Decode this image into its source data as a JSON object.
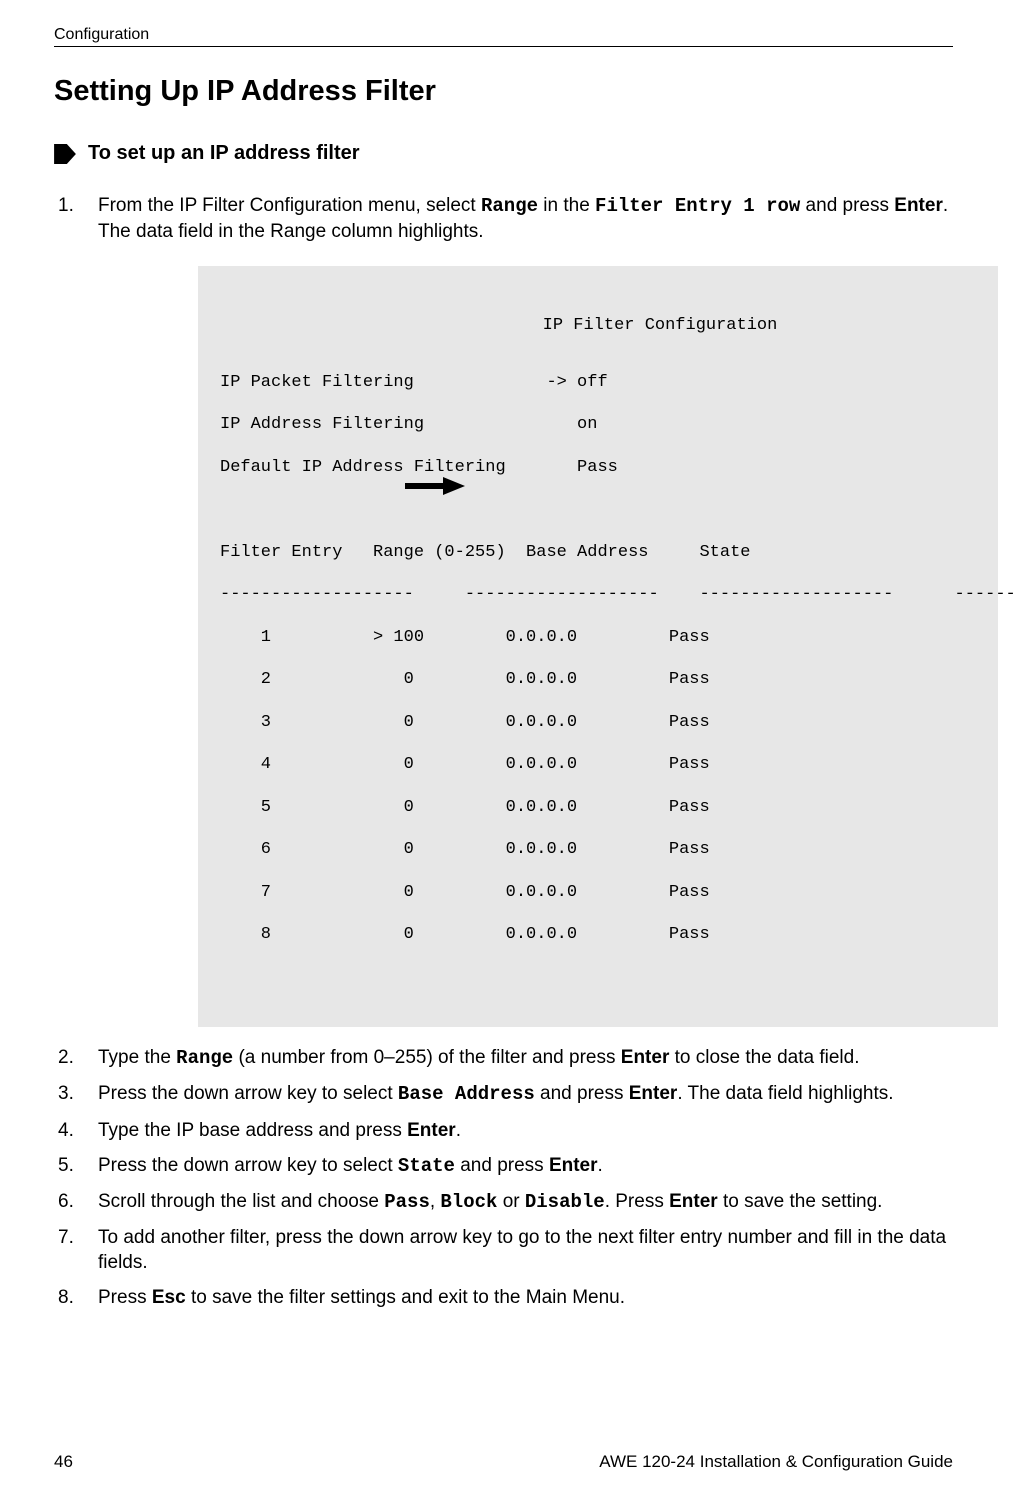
{
  "header": {
    "running": "Configuration"
  },
  "title": "Setting Up IP Address Filter",
  "task": "To set up an IP address filter",
  "steps": {
    "s1a": "From the IP Filter Configuration menu, select ",
    "s1b": "Range",
    "s1c": " in the ",
    "s1d": "Filter Entry 1 row",
    "s1e": " and press ",
    "s1f": "Enter",
    "s1g": ". The data field in the Range column highlights.",
    "s2a": "Type the ",
    "s2b": "Range",
    "s2c": " (a number from 0–255) of the filter and press ",
    "s2d": "Enter",
    "s2e": " to close the data field.",
    "s3a": "Press the down arrow key to select ",
    "s3b": "Base Address",
    "s3c": " and press ",
    "s3d": "Enter",
    "s3e": ". The data field highlights.",
    "s4a": "Type the IP base address and press ",
    "s4b": "Enter",
    "s4c": ".",
    "s5a": "Press the down arrow key to select ",
    "s5b": "State",
    "s5c": " and press ",
    "s5d": "Enter",
    "s5e": ".",
    "s6a": "Scroll through the list and choose ",
    "s6b": "Pass",
    "s6c": ", ",
    "s6d": "Block",
    "s6e": " or ",
    "s6f": "Disable",
    "s6g": ". Press ",
    "s6h": "Enter",
    "s6i": " to save the setting.",
    "s7a": "To add another filter,  press the down arrow key to go to the next filter entry number and fill in the data fields.",
    "s8a": "Press ",
    "s8b": "Esc",
    "s8c": " to save the filter settings and exit to the Main Menu."
  },
  "terminal": {
    "title": "IP Filter Configuration",
    "line1": "IP Packet Filtering             -> off",
    "line2": "IP Address Filtering               on",
    "line3": "Default IP Address Filtering       Pass",
    "header": "Filter Entry   Range (0-255)  Base Address     State",
    "ruler": "-------------------     -------------------    -------------------      -------------------",
    "rows": [
      "    1          > 100        0.0.0.0         Pass",
      "    2             0         0.0.0.0         Pass",
      "    3             0         0.0.0.0         Pass",
      "    4             0         0.0.0.0         Pass",
      "    5             0         0.0.0.0         Pass",
      "    6             0         0.0.0.0         Pass",
      "    7             0         0.0.0.0         Pass",
      "    8             0         0.0.0.0         Pass"
    ]
  },
  "footer": {
    "page": "46",
    "doc": "AWE 120-24 Installation & Configuration Guide"
  }
}
